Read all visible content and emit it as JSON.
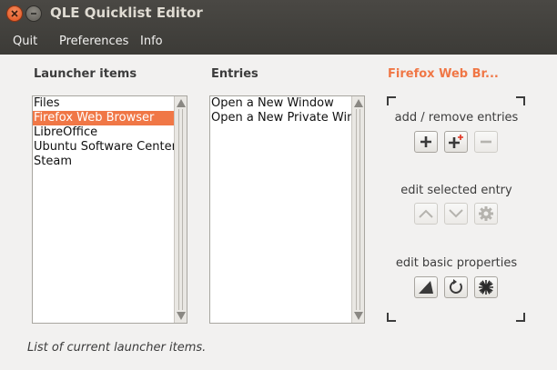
{
  "window": {
    "title": "QLE Quicklist Editor"
  },
  "menu": {
    "items": [
      "Quit",
      "Preferences",
      "Info"
    ]
  },
  "launcher": {
    "header": "Launcher items",
    "items": [
      "Files",
      "Firefox Web Browser",
      "LibreOffice",
      "Ubuntu Software Center",
      "Steam"
    ],
    "selected_index": 1
  },
  "entries": {
    "header": "Entries",
    "items": [
      "Open a New Window",
      "Open a New Private Window"
    ]
  },
  "panel": {
    "title": "Firefox Web Br...",
    "add_remove_label": "add / remove entries",
    "edit_selected_label": "edit selected entry",
    "edit_basic_label": "edit basic properties"
  },
  "icons": {
    "close": "close-icon",
    "minimize": "minimize-icon",
    "add": "plus-icon",
    "add_sub": "plus-star-icon",
    "remove": "minus-icon",
    "move_up": "chevron-up-icon",
    "move_down": "chevron-down-icon",
    "settings": "gear-icon",
    "launcher_icon": "triangle-icon",
    "reset": "refresh-icon",
    "icon_select": "starburst-icon"
  },
  "colors": {
    "accent": "#f07746",
    "titlebar": "#3c3b37",
    "background": "#f2f1f0"
  },
  "status": {
    "text": "List of current launcher items."
  }
}
